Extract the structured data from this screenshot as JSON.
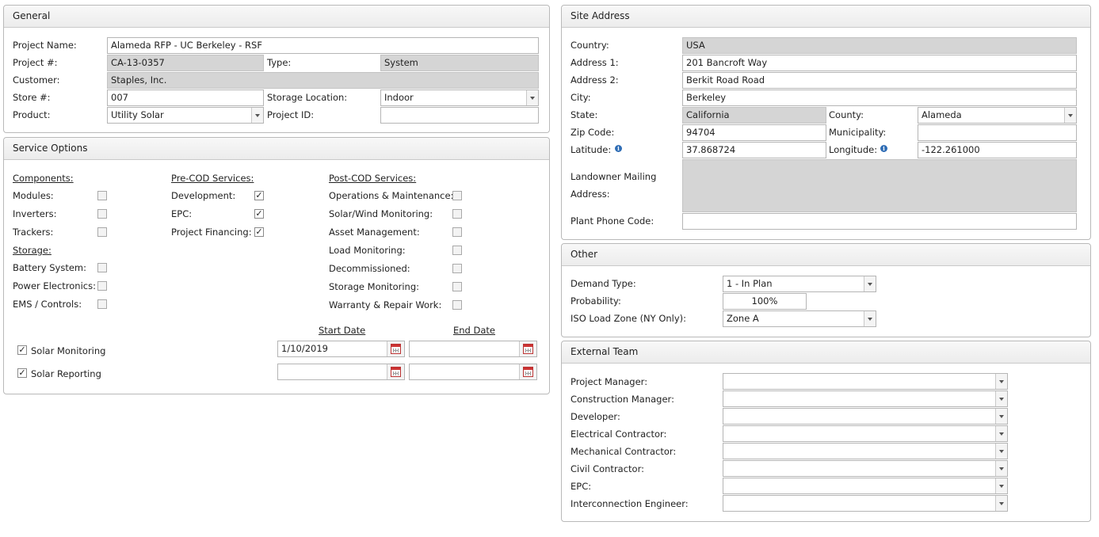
{
  "general": {
    "title": "General",
    "project_name_label": "Project Name:",
    "project_name": "Alameda RFP - UC Berkeley - RSF",
    "project_num_label": "Project #:",
    "project_num": "CA-13-0357",
    "type_label": "Type:",
    "type": "System",
    "customer_label": "Customer:",
    "customer": "Staples, Inc.",
    "store_label": "Store #:",
    "store": "007",
    "storage_location_label": "Storage Location:",
    "storage_location": "Indoor",
    "product_label": "Product:",
    "product": "Utility Solar",
    "project_id_label": "Project ID:",
    "project_id": ""
  },
  "service": {
    "title": "Service Options",
    "components_header": "Components:",
    "modules": "Modules:",
    "inverters": "Inverters:",
    "trackers": "Trackers:",
    "storage_header": "Storage:",
    "battery": "Battery System:",
    "power_electronics": "Power Electronics:",
    "ems": "EMS / Controls:",
    "precod_header": "Pre-COD Services:",
    "development": "Development:",
    "epc": "EPC:",
    "project_financing": "Project Financing:",
    "postcod_header": "Post-COD Services:",
    "om": "Operations & Maintenance:",
    "solar_wind": "Solar/Wind Monitoring:",
    "asset_mgmt": "Asset Management:",
    "load_monitoring": "Load Monitoring:",
    "decommissioned": "Decommissioned:",
    "storage_monitoring": "Storage Monitoring:",
    "warranty": "Warranty & Repair Work:",
    "check_mark": "✓",
    "start_date_header": "Start Date",
    "end_date_header": "End Date",
    "solar_monitoring": "Solar Monitoring",
    "solar_monitoring_start": "1/10/2019",
    "solar_monitoring_end": "",
    "solar_reporting": "Solar Reporting",
    "solar_reporting_start": "",
    "solar_reporting_end": ""
  },
  "site": {
    "title": "Site Address",
    "country_label": "Country:",
    "country": "USA",
    "address1_label": "Address 1:",
    "address1": "201 Bancroft Way",
    "address2_label": "Address 2:",
    "address2": "Berkit Road Road",
    "city_label": "City:",
    "city": "Berkeley",
    "state_label": "State:",
    "state": "California",
    "county_label": "County:",
    "county": "Alameda",
    "zip_label": "Zip Code:",
    "zip": "94704",
    "municipality_label": "Municipality:",
    "municipality": "",
    "latitude_label": "Latitude:",
    "latitude": "37.868724",
    "longitude_label": "Longitude:",
    "longitude": "-122.261000",
    "info_glyph": "i",
    "landowner_label_1": "Landowner Mailing",
    "landowner_label_2": "Address:",
    "landowner": "",
    "plant_phone_label": "Plant Phone Code:",
    "plant_phone": ""
  },
  "other": {
    "title": "Other",
    "demand_type_label": "Demand Type:",
    "demand_type": "1 - In Plan",
    "probability_label": "Probability:",
    "probability": "100%",
    "iso_label": "ISO Load Zone (NY Only):",
    "iso": "Zone A"
  },
  "external": {
    "title": "External Team",
    "roles": [
      {
        "label": "Project Manager:",
        "value": ""
      },
      {
        "label": "Construction Manager:",
        "value": ""
      },
      {
        "label": "Developer:",
        "value": ""
      },
      {
        "label": "Electrical Contractor:",
        "value": ""
      },
      {
        "label": "Mechanical Contractor:",
        "value": ""
      },
      {
        "label": "Civil Contractor:",
        "value": ""
      },
      {
        "label": "EPC:",
        "value": ""
      },
      {
        "label": "Interconnection Engineer:",
        "value": ""
      }
    ]
  }
}
